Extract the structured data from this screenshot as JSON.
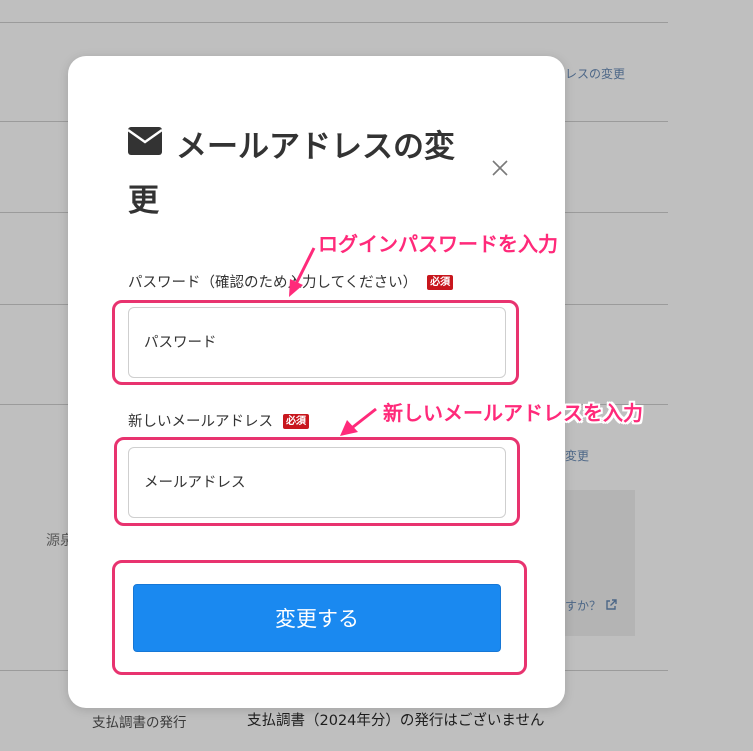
{
  "background": {
    "link_change_email": "レスの変更",
    "link_change_2": "変更",
    "link_help": "すか？",
    "label_source": "源泉",
    "footer_label": "支払調書の発行",
    "footer_value": "支払調書（2024年分）の発行はございません"
  },
  "modal": {
    "title": "メールアドレスの変更",
    "title_icon": "envelope-icon",
    "close_icon": "close-icon",
    "password_label": "パスワード（確認のため入力してください）",
    "password_required": "必須",
    "password_placeholder": "パスワード",
    "email_label": "新しいメールアドレス",
    "email_required": "必須",
    "email_placeholder": "メールアドレス",
    "submit_label": "変更する"
  },
  "annotations": {
    "callout_password": "ログインパスワードを入力",
    "callout_email": "新しいメールアドレスを入力",
    "accent_color": "#e8336f"
  },
  "colors": {
    "primary_button": "#1a89f0",
    "required_badge": "#c8161d",
    "overlay": "#7f7f7f"
  }
}
